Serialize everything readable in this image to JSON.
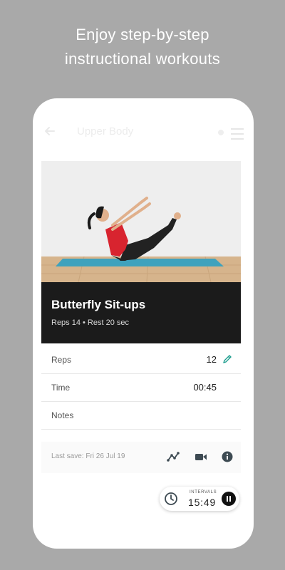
{
  "promo": {
    "headline_line1": "Enjoy step-by-step",
    "headline_line2": "instructional workouts"
  },
  "appbar": {
    "title": "Upper Body",
    "back_icon": "arrow-back-icon",
    "menu_icon": "menu-icon"
  },
  "exercise": {
    "name": "Butterfly Sit-ups",
    "subtitle": "Reps 14 • Rest 20 sec"
  },
  "fields": {
    "reps_label": "Reps",
    "reps_value": "12",
    "time_label": "Time",
    "time_value": "00:45",
    "notes_label": "Notes"
  },
  "footer": {
    "last_save": "Last save: Fri 26 Jul 19",
    "icons": [
      "chart-icon",
      "video-icon",
      "info-icon"
    ]
  },
  "timer": {
    "label": "INTERVALS",
    "time": "15:49"
  },
  "colors": {
    "accent": "#1f9e8f",
    "background": "#a9a9a9",
    "info_bar": "#1b1b1b",
    "mat": "#3fa2bd",
    "top": "#d8242f"
  }
}
